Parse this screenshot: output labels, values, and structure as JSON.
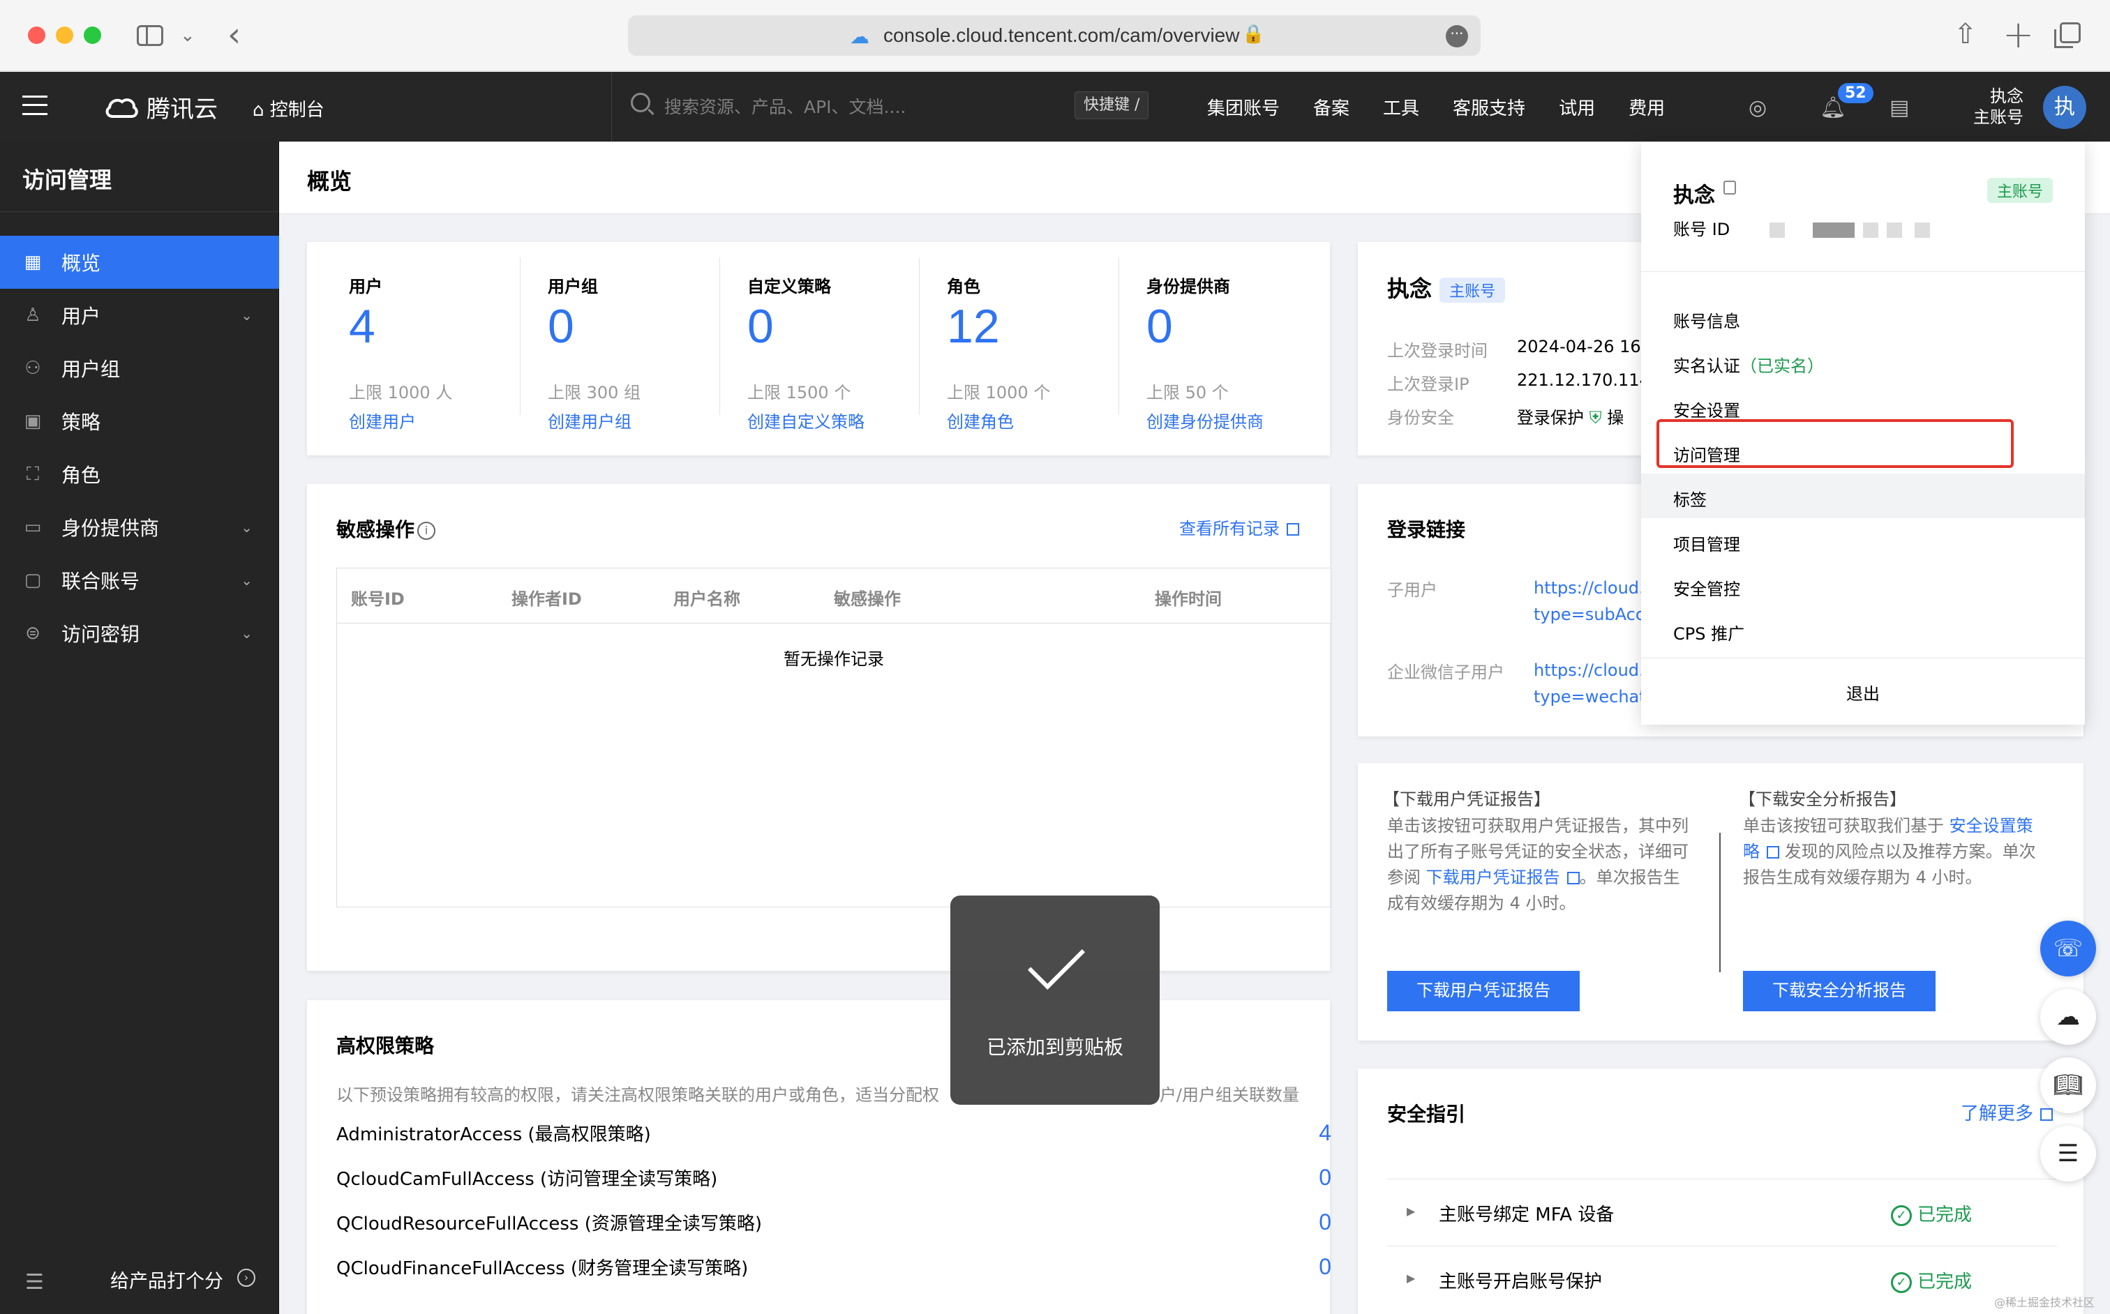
{
  "browser": {
    "url": "console.cloud.tencent.com/cam/overview"
  },
  "topnav": {
    "brand": "腾讯云",
    "console": "控制台",
    "search_placeholder": "搜索资源、产品、API、文档....",
    "shortcut": "快捷键 /",
    "items": [
      "集团账号",
      "备案",
      "工具",
      "客服支持",
      "试用",
      "费用"
    ],
    "notification_count": "52",
    "user_name": "执念",
    "user_role": "主账号",
    "avatar_char": "执"
  },
  "sidebar": {
    "title": "访问管理",
    "items": [
      {
        "label": "概览",
        "icon": "grid-icon",
        "active": true,
        "expandable": false
      },
      {
        "label": "用户",
        "icon": "user-icon",
        "active": false,
        "expandable": true
      },
      {
        "label": "用户组",
        "icon": "users-icon",
        "active": false,
        "expandable": false
      },
      {
        "label": "策略",
        "icon": "policy-icon",
        "active": false,
        "expandable": false
      },
      {
        "label": "角色",
        "icon": "role-icon",
        "active": false,
        "expandable": false
      },
      {
        "label": "身份提供商",
        "icon": "idp-icon",
        "active": false,
        "expandable": true
      },
      {
        "label": "联合账号",
        "icon": "federated-icon",
        "active": false,
        "expandable": true
      },
      {
        "label": "访问密钥",
        "icon": "key-icon",
        "active": false,
        "expandable": true
      }
    ],
    "rate_label": "给产品打个分"
  },
  "page": {
    "title": "概览"
  },
  "stats": [
    {
      "label": "用户",
      "value": "4",
      "limit": "上限 1000 人",
      "link": "创建用户"
    },
    {
      "label": "用户组",
      "value": "0",
      "limit": "上限 300 组",
      "link": "创建用户组"
    },
    {
      "label": "自定义策略",
      "value": "0",
      "limit": "上限 1500 个",
      "link": "创建自定义策略"
    },
    {
      "label": "角色",
      "value": "12",
      "limit": "上限 1000 个",
      "link": "创建角色"
    },
    {
      "label": "身份提供商",
      "value": "0",
      "limit": "上限 50 个",
      "link": "创建身份提供商"
    }
  ],
  "sensitive": {
    "title": "敏感操作",
    "view_all": "查看所有记录",
    "columns": [
      "账号ID",
      "操作者ID",
      "用户名称",
      "敏感操作",
      "操作时间"
    ],
    "empty": "暂无操作记录"
  },
  "high_priv": {
    "title": "高权限策略",
    "desc": "以下预设策略拥有较高的权限，请关注高权限策略关联的用户或角色，适当分配权",
    "desc_tail": "户/用户组关联数量",
    "policies": [
      {
        "name": "AdministratorAccess (最高权限策略)",
        "count": "4"
      },
      {
        "name": "QcloudCamFullAccess (访问管理全读写策略)",
        "count": "0"
      },
      {
        "name": "QCloudResourceFullAccess (资源管理全读写策略)",
        "count": "0"
      },
      {
        "name": "QCloudFinanceFullAccess (财务管理全读写策略)",
        "count": "0"
      }
    ]
  },
  "account_card": {
    "name": "执念",
    "badge": "主账号",
    "last_login_time_label": "上次登录时间",
    "last_login_time": "2024-04-26 16",
    "last_login_ip_label": "上次登录IP",
    "last_login_ip": "221.12.170.114",
    "security_label": "身份安全",
    "security_value": "登录保护",
    "security_extra": "操"
  },
  "login_links": {
    "title": "登录链接",
    "rows": [
      {
        "label": "子用户",
        "line1": "https://cloud.",
        "line2": "type=subAcc"
      },
      {
        "label": "企业微信子用户",
        "line1": "https://cloud.",
        "line2": "type=wechat"
      }
    ]
  },
  "reports": {
    "left_title": "【下载用户凭证报告】",
    "left_desc_1": "单击该按钮可获取用户凭证报告，其中列",
    "left_desc_2": "出了所有子账号凭证的安全状态，详细可",
    "left_desc_3a": "参阅 ",
    "left_desc_3_link": "下载用户凭证报告",
    "left_desc_3b": "。单次报告生",
    "left_desc_4": "成有效缓存期为 4 小时。",
    "left_button": "下载用户凭证报告",
    "right_title": "【下载安全分析报告】",
    "right_desc_1a": "单击该按钮可获取我们基于 ",
    "right_desc_1_link": "安全设置策",
    "right_desc_2_link": "略",
    "right_desc_2b": " 发现的风险点以及推荐方案。单次",
    "right_desc_3": "报告生成有效缓存期为 4 小时。",
    "right_button": "下载安全分析报告"
  },
  "security_guide": {
    "title": "安全指引",
    "learn_more": "了解更多",
    "items": [
      {
        "label": "主账号绑定 MFA 设备",
        "status": "已完成"
      },
      {
        "label": "主账号开启账号保护",
        "status": "已完成"
      }
    ]
  },
  "dropdown": {
    "name": "执念",
    "badge": "主账号",
    "id_label": "账号 ID",
    "items": [
      {
        "label": "账号信息"
      },
      {
        "label": "实名认证",
        "suffix": "（已实名）"
      },
      {
        "label": "安全设置"
      },
      {
        "label": "访问管理",
        "highlighted": true
      },
      {
        "label": "标签",
        "hover": true
      },
      {
        "label": "项目管理"
      },
      {
        "label": "安全管控"
      },
      {
        "label": "CPS 推广"
      }
    ],
    "logout": "退出"
  },
  "toast": {
    "text": "已添加到剪贴板"
  },
  "watermark": "@稀土掘金技术社区",
  "colors": {
    "accent": "#2e73f2",
    "nav_bg": "#262626",
    "success": "#1d9b4f",
    "highlight_border": "#e4342a"
  }
}
